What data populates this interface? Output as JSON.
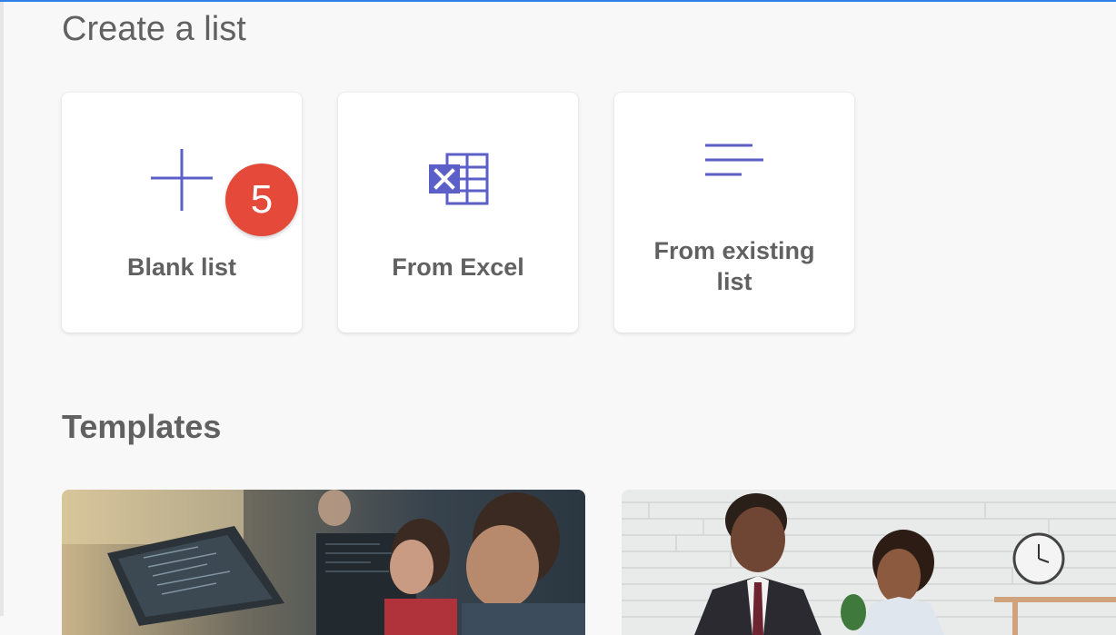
{
  "header": {
    "title": "Create a list"
  },
  "create_options": [
    {
      "label": "Blank list",
      "icon": "plus-icon"
    },
    {
      "label": "From Excel",
      "icon": "excel-icon"
    },
    {
      "label": "From existing list",
      "icon": "list-lines-icon"
    }
  ],
  "step_badge": {
    "value": "5",
    "color": "#e5493a"
  },
  "templates": {
    "title": "Templates",
    "items": [
      {
        "image": "developers-at-computers-photo"
      },
      {
        "image": "colleagues-handshake-office-photo"
      }
    ]
  },
  "colors": {
    "accent": "#5b5fc7",
    "top_bar": "#2f7fe6",
    "text": "#616161"
  }
}
